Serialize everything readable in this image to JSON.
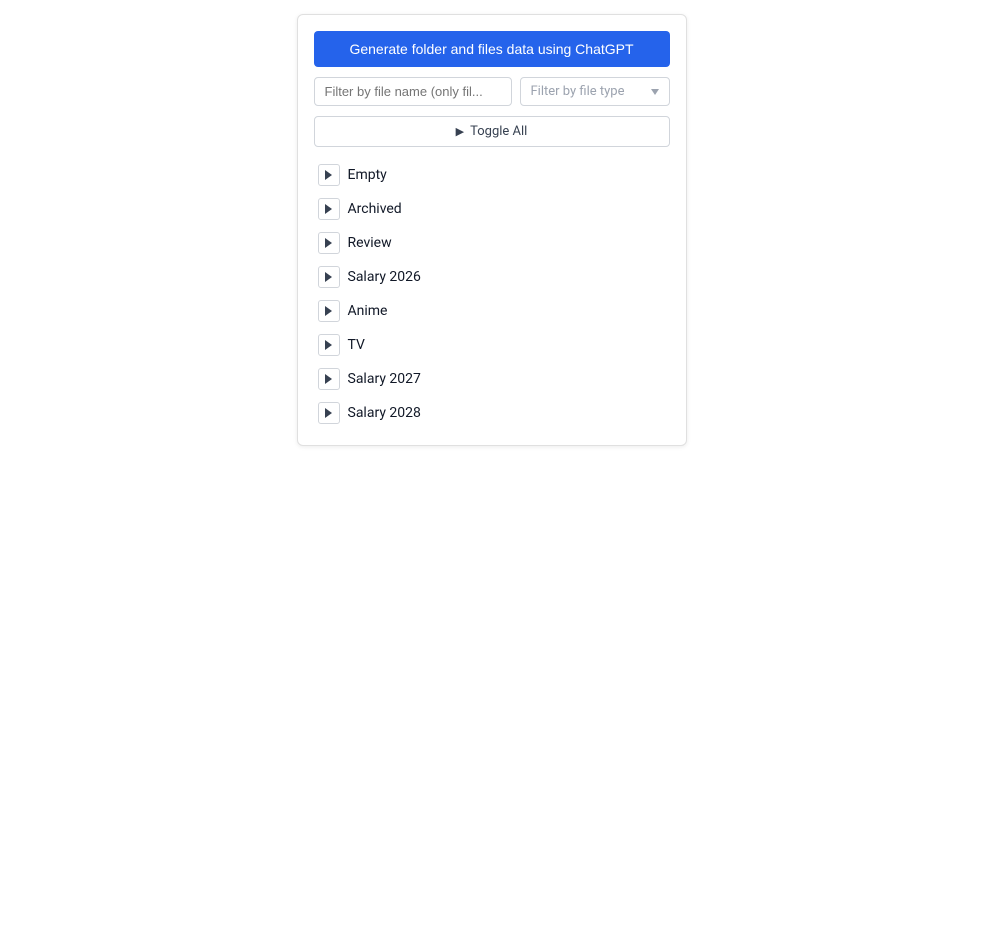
{
  "header": {
    "generate_btn_label": "Generate folder and files data using ChatGPT"
  },
  "filters": {
    "name_placeholder": "Filter by file name (only fil...",
    "type_placeholder": "Filter by file type",
    "type_chevron": "▾"
  },
  "toggle_all": {
    "label": "Toggle All",
    "icon": "▶"
  },
  "folders": [
    {
      "id": 1,
      "name": "Empty"
    },
    {
      "id": 2,
      "name": "Archived"
    },
    {
      "id": 3,
      "name": "Review"
    },
    {
      "id": 4,
      "name": "Salary 2026"
    },
    {
      "id": 5,
      "name": "Anime"
    },
    {
      "id": 6,
      "name": "TV"
    },
    {
      "id": 7,
      "name": "Salary 2027"
    },
    {
      "id": 8,
      "name": "Salary 2028"
    }
  ]
}
